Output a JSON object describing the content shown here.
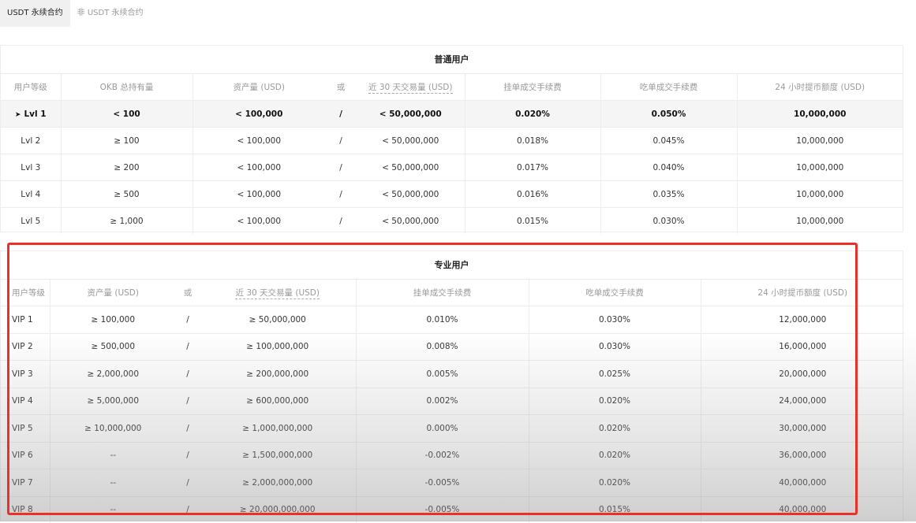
{
  "tabs": [
    "USDT 永续合约",
    "非 USDT 永续合约"
  ],
  "normal": {
    "title": "普通用户",
    "headers": [
      "用户等级",
      "OKB 总持有量",
      "资产量 (USD)",
      "或",
      "近 30 天交易量 (USD)",
      "挂单成交手续费",
      "吃单成交手续费",
      "24 小时提币额度 (USD)"
    ],
    "current_marker": "➤",
    "rows": [
      [
        "Lvl 1",
        "< 100",
        "< 100,000",
        "/",
        "< 50,000,000",
        "0.020%",
        "0.050%",
        "10,000,000"
      ],
      [
        "Lvl 2",
        "≥ 100",
        "< 100,000",
        "/",
        "< 50,000,000",
        "0.018%",
        "0.045%",
        "10,000,000"
      ],
      [
        "Lvl 3",
        "≥ 200",
        "< 100,000",
        "/",
        "< 50,000,000",
        "0.017%",
        "0.040%",
        "10,000,000"
      ],
      [
        "Lvl 4",
        "≥ 500",
        "< 100,000",
        "/",
        "< 50,000,000",
        "0.016%",
        "0.035%",
        "10,000,000"
      ],
      [
        "Lvl 5",
        "≥ 1,000",
        "< 100,000",
        "/",
        "< 50,000,000",
        "0.015%",
        "0.030%",
        "10,000,000"
      ]
    ]
  },
  "pro": {
    "title": "专业用户",
    "headers": [
      "用户等级",
      "资产量 (USD)",
      "或",
      "近 30 天交易量 (USD)",
      "挂单成交手续费",
      "吃单成交手续费",
      "24 小时提币额度 (USD)"
    ],
    "rows": [
      [
        "VIP 1",
        "≥ 100,000",
        "/",
        "≥ 50,000,000",
        "0.010%",
        "0.030%",
        "12,000,000"
      ],
      [
        "VIP 2",
        "≥ 500,000",
        "/",
        "≥ 100,000,000",
        "0.008%",
        "0.030%",
        "16,000,000"
      ],
      [
        "VIP 3",
        "≥ 2,000,000",
        "/",
        "≥ 200,000,000",
        "0.005%",
        "0.025%",
        "20,000,000"
      ],
      [
        "VIP 4",
        "≥ 5,000,000",
        "/",
        "≥ 600,000,000",
        "0.002%",
        "0.020%",
        "24,000,000"
      ],
      [
        "VIP 5",
        "≥ 10,000,000",
        "/",
        "≥ 1,000,000,000",
        "0.000%",
        "0.020%",
        "30,000,000"
      ],
      [
        "VIP 6",
        "--",
        "/",
        "≥ 1,500,000,000",
        "-0.002%",
        "0.020%",
        "36,000,000"
      ],
      [
        "VIP 7",
        "--",
        "/",
        "≥ 2,000,000,000",
        "-0.005%",
        "0.020%",
        "40,000,000"
      ],
      [
        "VIP 8",
        "--",
        "/",
        "≥ 20,000,000,000",
        "-0.005%",
        "0.015%",
        "40,000,000"
      ]
    ]
  },
  "colors": {
    "highlight": "#e8312a",
    "border": "#ececec",
    "muted": "#999999"
  }
}
